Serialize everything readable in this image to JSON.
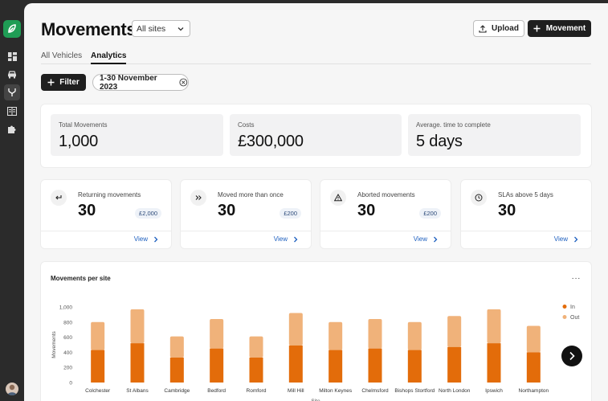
{
  "page": {
    "title": "Movements",
    "site_select": {
      "value": "All sites"
    },
    "upload_label": "Upload",
    "movement_label": "Movement",
    "tabs": [
      {
        "label": "All Vehicles",
        "active": false
      },
      {
        "label": "Analytics",
        "active": true
      }
    ],
    "filter_label": "Filter",
    "date_chip": "1-30 November 2023"
  },
  "summary": [
    {
      "label": "Total Movements",
      "value": "1,000"
    },
    {
      "label": "Costs",
      "value": "£300,000"
    },
    {
      "label": "Average. time to complete",
      "value": "5 days"
    }
  ],
  "metrics": [
    {
      "label": "Returning movements",
      "value": "30",
      "badge": "£2,000",
      "view": "View",
      "icon": "return-arrow-icon"
    },
    {
      "label": "Moved more than once",
      "value": "30",
      "badge": "£200",
      "view": "View",
      "icon": "double-chevron-icon"
    },
    {
      "label": "Aborted movements",
      "value": "30",
      "badge": "£200",
      "view": "View",
      "icon": "warning-icon"
    },
    {
      "label": "SLAs above 5 days",
      "value": "30",
      "badge": "",
      "view": "View",
      "icon": "clock-icon"
    }
  ],
  "chart_title": "Movements per site",
  "chart_more": "···",
  "colors": {
    "in": "#e36c0a",
    "out": "#f0b27a",
    "accent": "#1f9d55",
    "link": "#1d5fbf"
  },
  "chart_data": {
    "type": "bar",
    "stacked": true,
    "title": "Movements per site",
    "xlabel": "Site",
    "ylabel": "Movements",
    "ylim": [
      0,
      1000
    ],
    "yticks": [
      "0",
      "200",
      "400",
      "600",
      "800",
      "1,000"
    ],
    "legend_position": "top-right",
    "categories": [
      "Colchester",
      "St Albans",
      "Cambridge",
      "Bedford",
      "Romford",
      "Mill Hill",
      "Milton Keynes",
      "Chelmsford",
      "Bishops Stortford",
      "North London",
      "Ipswich",
      "Northampton"
    ],
    "series": [
      {
        "name": "In",
        "values": [
          430,
          520,
          330,
          450,
          330,
          490,
          430,
          450,
          430,
          470,
          520,
          400
        ]
      },
      {
        "name": "Out",
        "values": [
          370,
          450,
          280,
          390,
          280,
          430,
          370,
          390,
          370,
          410,
          450,
          350
        ]
      }
    ]
  }
}
